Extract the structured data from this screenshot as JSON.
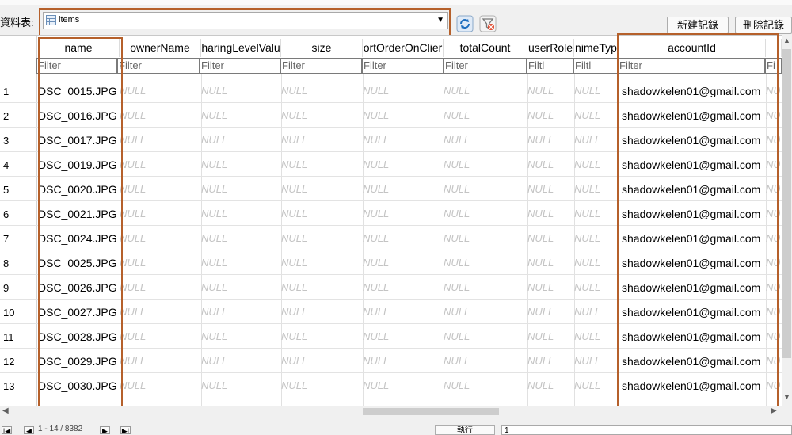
{
  "toolbar": {
    "table_label": "資料表:",
    "table_name": "items",
    "new_record_label": "新建記錄",
    "delete_record_label": "刪除記錄"
  },
  "columns": [
    {
      "header": "name",
      "filter": "Filter"
    },
    {
      "header": "ownerName",
      "filter": "Filter"
    },
    {
      "header": "haringLevelValu",
      "filter": "Filter"
    },
    {
      "header": "size",
      "filter": "Filter"
    },
    {
      "header": "ortOrderOnClier",
      "filter": "Filter"
    },
    {
      "header": "totalCount",
      "filter": "Filter"
    },
    {
      "header": "userRole",
      "filter": "Filtl"
    },
    {
      "header": "nimeTyp",
      "filter": "Filtl"
    },
    {
      "header": "accountId",
      "filter": "Filter"
    },
    {
      "header": "",
      "filter": "Fi"
    }
  ],
  "null_text": "NULL",
  "rows": [
    {
      "num": "1",
      "name": "DSC_0015.JPG",
      "accountId": "shadowkelen01@gmail.com"
    },
    {
      "num": "2",
      "name": "DSC_0016.JPG",
      "accountId": "shadowkelen01@gmail.com"
    },
    {
      "num": "3",
      "name": "DSC_0017.JPG",
      "accountId": "shadowkelen01@gmail.com"
    },
    {
      "num": "4",
      "name": "DSC_0019.JPG",
      "accountId": "shadowkelen01@gmail.com"
    },
    {
      "num": "5",
      "name": "DSC_0020.JPG",
      "accountId": "shadowkelen01@gmail.com"
    },
    {
      "num": "6",
      "name": "DSC_0021.JPG",
      "accountId": "shadowkelen01@gmail.com"
    },
    {
      "num": "7",
      "name": "DSC_0024.JPG",
      "accountId": "shadowkelen01@gmail.com"
    },
    {
      "num": "8",
      "name": "DSC_0025.JPG",
      "accountId": "shadowkelen01@gmail.com"
    },
    {
      "num": "9",
      "name": "DSC_0026.JPG",
      "accountId": "shadowkelen01@gmail.com"
    },
    {
      "num": "10",
      "name": "DSC_0027.JPG",
      "accountId": "shadowkelen01@gmail.com"
    },
    {
      "num": "11",
      "name": "DSC_0028.JPG",
      "accountId": "shadowkelen01@gmail.com"
    },
    {
      "num": "12",
      "name": "DSC_0029.JPG",
      "accountId": "shadowkelen01@gmail.com"
    },
    {
      "num": "13",
      "name": "DSC_0030.JPG",
      "accountId": "shadowkelen01@gmail.com"
    }
  ],
  "footer": {
    "page_info": "1 - 14 / 8382",
    "go_button": "執行",
    "go_value": "1"
  },
  "colors": {
    "highlight": "#b5602b",
    "null_text": "#c4c4c4"
  }
}
